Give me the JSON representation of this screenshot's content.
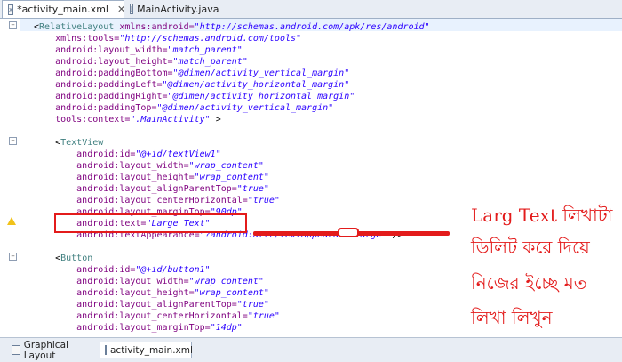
{
  "tabs": [
    {
      "label": "*activity_main.xml",
      "active": true,
      "close": "✕"
    },
    {
      "label": "MainActivity.java",
      "active": false
    }
  ],
  "code": [
    [
      {
        "t": "punct",
        "v": "<"
      },
      {
        "t": "tag",
        "v": "RelativeLayout"
      },
      {
        "t": "attr",
        "v": " xmlns:android="
      },
      {
        "t": "val",
        "v": "\"http://schemas.android.com/apk/res/android\""
      }
    ],
    [
      {
        "t": "attr",
        "v": "    xmlns:tools="
      },
      {
        "t": "val",
        "v": "\"http://schemas.android.com/tools\""
      }
    ],
    [
      {
        "t": "attr",
        "v": "    android:layout_width="
      },
      {
        "t": "val",
        "v": "\"match_parent\""
      }
    ],
    [
      {
        "t": "attr",
        "v": "    android:layout_height="
      },
      {
        "t": "val",
        "v": "\"match_parent\""
      }
    ],
    [
      {
        "t": "attr",
        "v": "    android:paddingBottom="
      },
      {
        "t": "val",
        "v": "\"@dimen/activity_vertical_margin\""
      }
    ],
    [
      {
        "t": "attr",
        "v": "    android:paddingLeft="
      },
      {
        "t": "val",
        "v": "\"@dimen/activity_horizontal_margin\""
      }
    ],
    [
      {
        "t": "attr",
        "v": "    android:paddingRight="
      },
      {
        "t": "val",
        "v": "\"@dimen/activity_horizontal_margin\""
      }
    ],
    [
      {
        "t": "attr",
        "v": "    android:paddingTop="
      },
      {
        "t": "val",
        "v": "\"@dimen/activity_vertical_margin\""
      }
    ],
    [
      {
        "t": "attr",
        "v": "    tools:context="
      },
      {
        "t": "val",
        "v": "\".MainActivity\""
      },
      {
        "t": "punct",
        "v": " >"
      }
    ],
    [],
    [
      {
        "t": "punct",
        "v": "    <"
      },
      {
        "t": "tag",
        "v": "TextView"
      }
    ],
    [
      {
        "t": "attr",
        "v": "        android:id="
      },
      {
        "t": "val",
        "v": "\"@+id/textView1\""
      }
    ],
    [
      {
        "t": "attr",
        "v": "        android:layout_width="
      },
      {
        "t": "val",
        "v": "\"wrap_content\""
      }
    ],
    [
      {
        "t": "attr",
        "v": "        android:layout_height="
      },
      {
        "t": "val",
        "v": "\"wrap_content\""
      }
    ],
    [
      {
        "t": "attr",
        "v": "        android:layout_alignParentTop="
      },
      {
        "t": "val",
        "v": "\"true\""
      }
    ],
    [
      {
        "t": "attr",
        "v": "        android:layout_centerHorizontal="
      },
      {
        "t": "val",
        "v": "\"true\""
      }
    ],
    [
      {
        "t": "attr",
        "v": "        android:layout_marginTop="
      },
      {
        "t": "val",
        "v": "\"90dp\""
      }
    ],
    [
      {
        "t": "attr",
        "v": "        android:text="
      },
      {
        "t": "val",
        "v": "\"Large Text\""
      }
    ],
    [
      {
        "t": "attr",
        "v": "        android:textAppearance="
      },
      {
        "t": "val",
        "v": "\"?android:attr/textAppearanceLarge\""
      },
      {
        "t": "punct",
        "v": " />"
      }
    ],
    [],
    [
      {
        "t": "punct",
        "v": "    <"
      },
      {
        "t": "tag",
        "v": "Button"
      }
    ],
    [
      {
        "t": "attr",
        "v": "        android:id="
      },
      {
        "t": "val",
        "v": "\"@+id/button1\""
      }
    ],
    [
      {
        "t": "attr",
        "v": "        android:layout_width="
      },
      {
        "t": "val",
        "v": "\"wrap_content\""
      }
    ],
    [
      {
        "t": "attr",
        "v": "        android:layout_height="
      },
      {
        "t": "val",
        "v": "\"wrap_content\""
      }
    ],
    [
      {
        "t": "attr",
        "v": "        android:layout_alignParentTop="
      },
      {
        "t": "val",
        "v": "\"true\""
      }
    ],
    [
      {
        "t": "attr",
        "v": "        android:layout_centerHorizontal="
      },
      {
        "t": "val",
        "v": "\"true\""
      }
    ],
    [
      {
        "t": "attr",
        "v": "        android:layout_marginTop="
      },
      {
        "t": "val",
        "v": "\"14dp\""
      }
    ]
  ],
  "annotation": {
    "line1": "Larg Text লিখাটা",
    "line2": "ডিলিট করে দিয়ে",
    "line3": "নিজের ইচ্ছে মত",
    "line4": "লিখা লিখুন"
  },
  "bottom_tabs": [
    {
      "label": "Graphical Layout"
    },
    {
      "label": "activity_main.xml"
    }
  ],
  "colors": {
    "annotation": "#e31b1b",
    "tag": "#3f7f7f",
    "attr": "#7f007f",
    "value": "#2a00ff"
  }
}
